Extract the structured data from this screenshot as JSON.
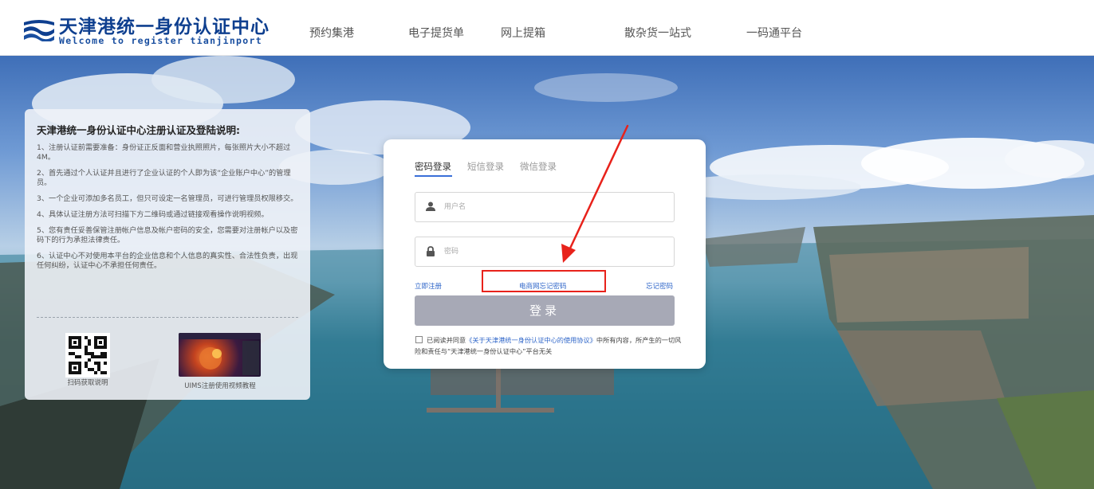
{
  "header": {
    "logo_title": "天津港统一身份认证中心",
    "logo_subtitle": "Welcome to register tianjinport",
    "logo_icon": "wave-logo-icon",
    "nav": [
      "预约集港",
      "电子提货单",
      "网上提箱",
      "散杂货一站式",
      "一码通平台"
    ]
  },
  "info_panel": {
    "title": "天津港统一身份认证中心注册认证及登陆说明:",
    "items": [
      "1、注册认证前需要准备：身份证正反面和营业执照照片，每张照片大小不超过4M。",
      "2、首先通过个人认证并且进行了企业认证的个人即为该“企业账户中心”的管理员。",
      "3、一个企业可添加多名员工，但只可设定一名管理员，可进行管理员权限移交。",
      "4、具体认证注册方法可扫描下方二维码或通过链接观看操作说明视频。",
      "5、您有责任妥善保管注册帐户信息及帐户密码的安全，您需要对注册帐户以及密码下的行为承担法律责任。",
      "6、认证中心不对使用本平台的企业信息和个人信息的真实性、合法性负责，出现任何纠纷，认证中心不承担任何责任。"
    ],
    "qr_label": "扫码获取说明",
    "video_label": "UIMS注册使用视频教程"
  },
  "login": {
    "tabs": [
      "密码登录",
      "短信登录",
      "微信登录"
    ],
    "active_tab": 0,
    "username_placeholder": "用户名",
    "password_placeholder": "密码",
    "register_link": "立即注册",
    "ecommerce_forgot_link": "电商网忘记密码",
    "forgot_link": "忘记密码",
    "login_button": "登录",
    "agree_prefix": "已阅读并同意",
    "agree_doc": "《关于天津港统一身份认证中心的使用协议》",
    "agree_suffix": "中所有内容，所产生的一切风险和责任与“天津港统一身份认证中心”平台无关"
  },
  "colors": {
    "brand": "#0e3f8f",
    "link": "#2f66c9",
    "login_button": "#a7a9b6",
    "annotation": "#e8221b"
  }
}
